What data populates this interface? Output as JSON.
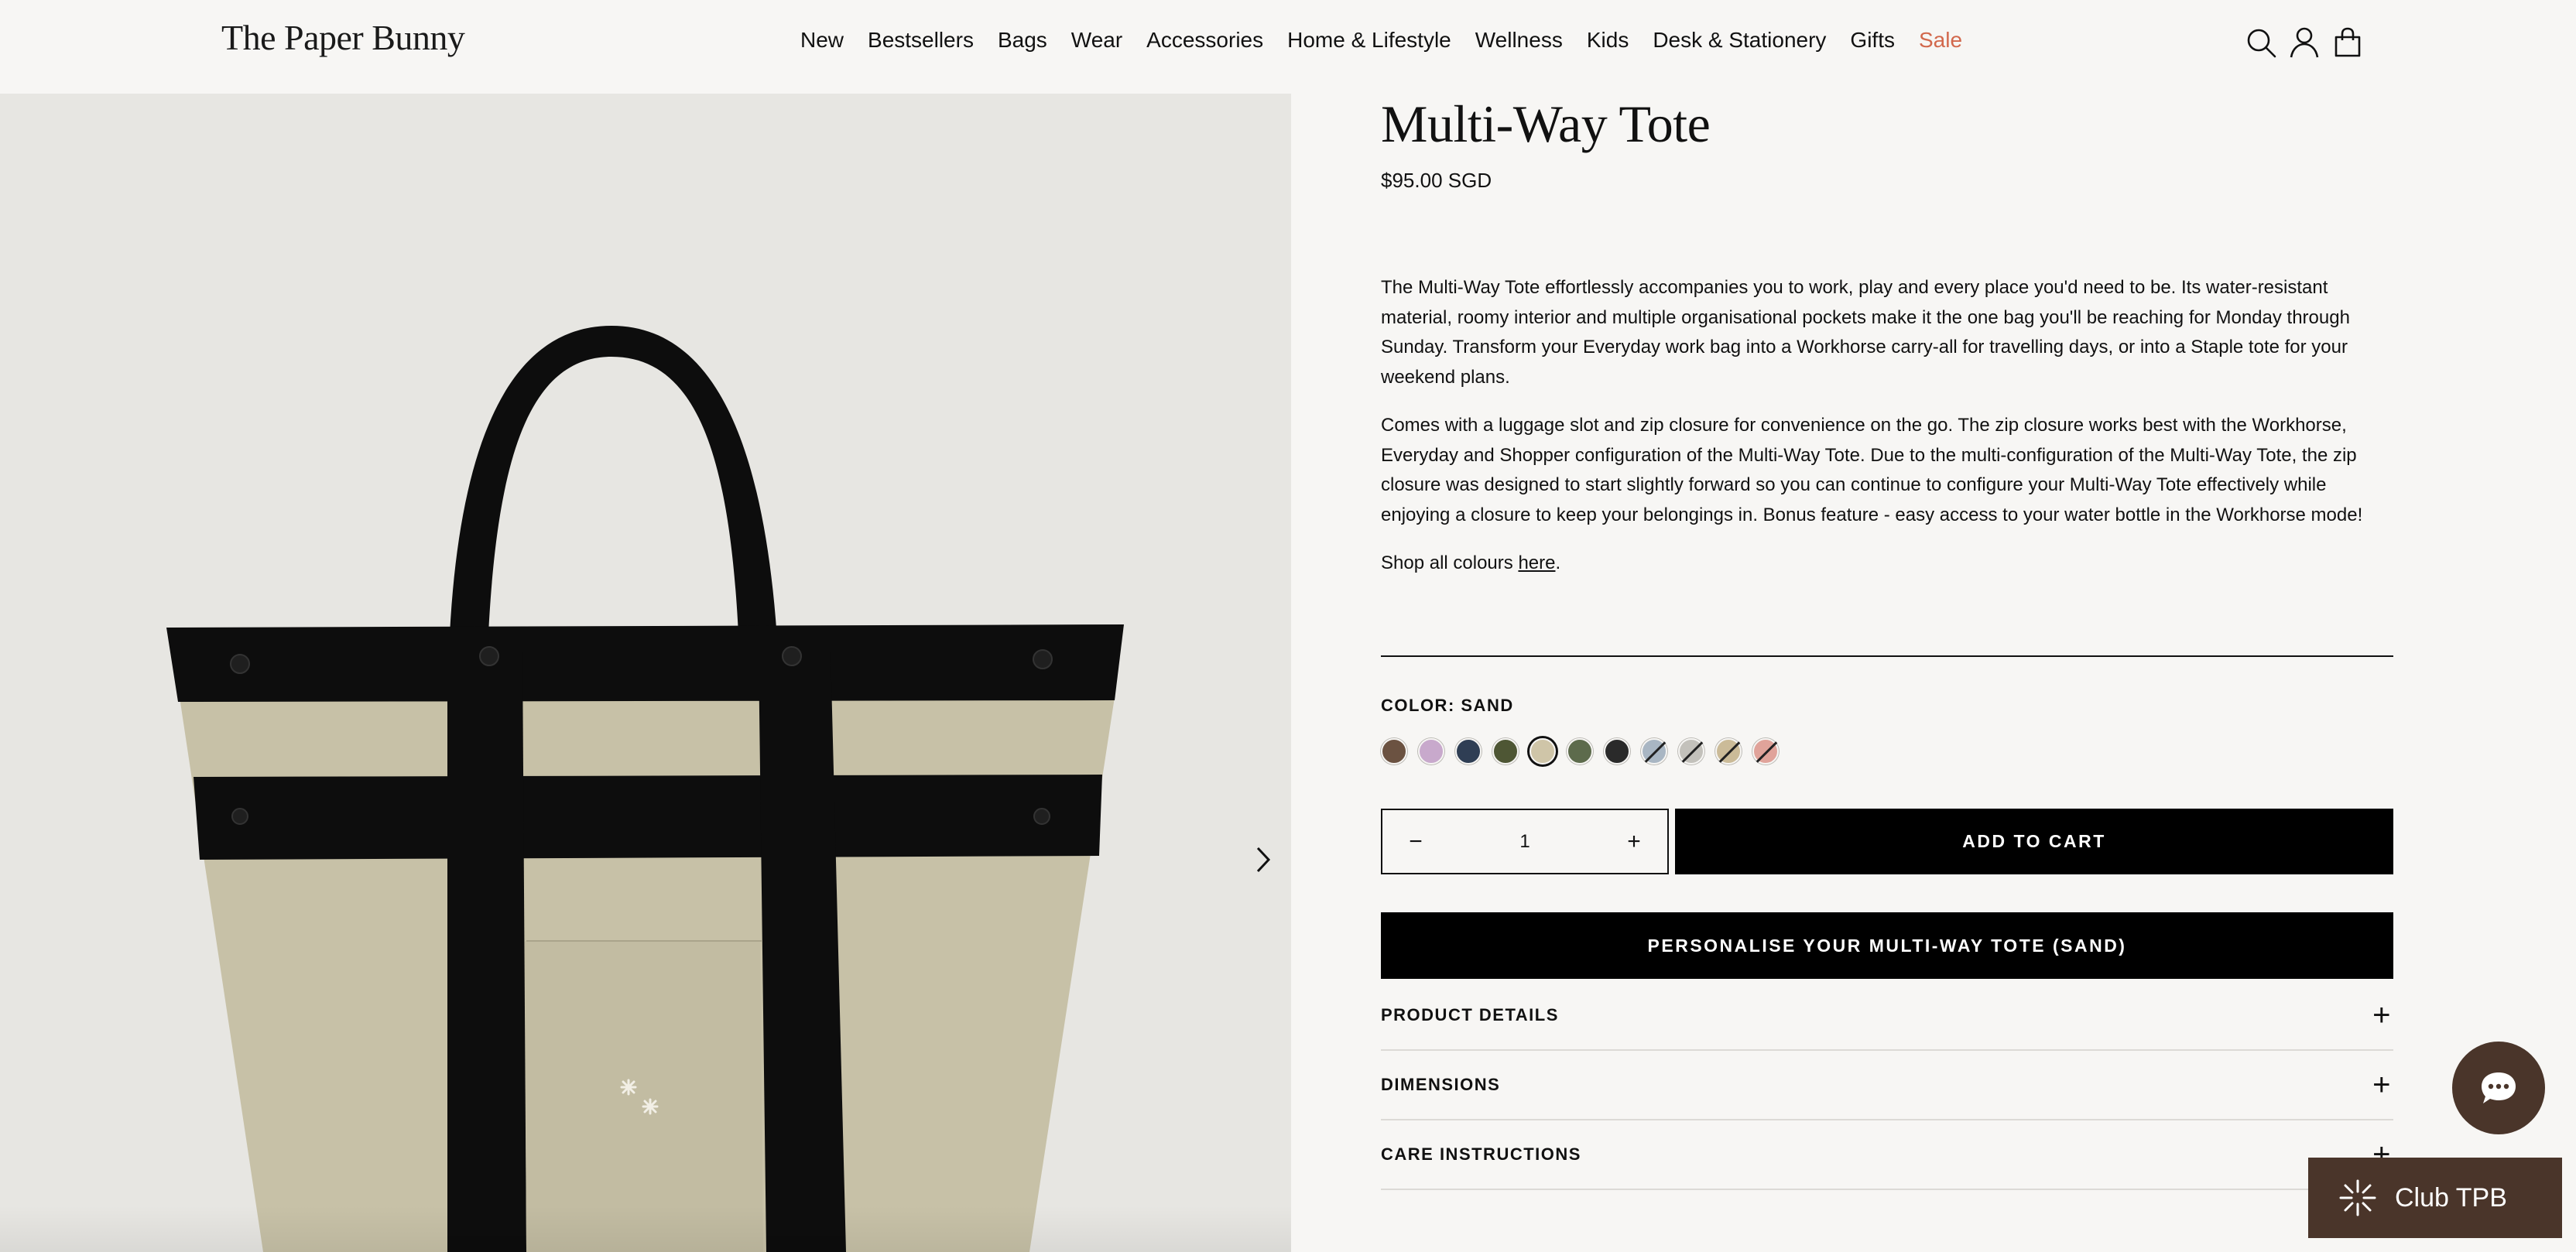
{
  "header": {
    "logo": "The Paper Bunny",
    "nav": [
      "New",
      "Bestsellers",
      "Bags",
      "Wear",
      "Accessories",
      "Home & Lifestyle",
      "Wellness",
      "Kids",
      "Desk & Stationery",
      "Gifts",
      "Sale"
    ],
    "icons": [
      "search-icon",
      "account-icon",
      "cart-bag-icon"
    ]
  },
  "product": {
    "title": "Multi-Way Tote",
    "price": "$95.00 SGD",
    "description": [
      "The Multi-Way Tote effortlessly accompanies you to work, play and every place you'd need to be. Its water-resistant material, roomy interior and multiple organisational pockets make it the one bag you'll be reaching for Monday through Sunday. Transform your Everyday work bag into a Workhorse carry-all for travelling days, or into a Staple tote for your weekend plans.",
      "Comes with a luggage slot and zip closure for convenience on the go. The zip closure works best with the Workhorse, Everyday and Shopper configuration of the Multi-Way Tote. Due to the multi-configuration of the Multi-Way Tote, the zip closure was designed to start slightly forward so you can continue to configure your Multi-Way Tote effectively while enjoying a closure to keep your belongings in. Bonus feature - easy access to your water bottle in the Workhorse mode!"
    ],
    "shop_all_prefix": "Shop all colours ",
    "shop_all_link": "here",
    "shop_all_suffix": ".",
    "color_label": "COLOR: SAND",
    "swatches": [
      {
        "color": "#6b5241",
        "split": false
      },
      {
        "color": "#c8a9cc",
        "split": false
      },
      {
        "color": "#2f3e54",
        "split": false
      },
      {
        "color": "#4e5634",
        "split": false
      },
      {
        "color": "#cfc5a8",
        "split": false,
        "selected": true
      },
      {
        "color": "#5d6b4c",
        "split": false
      },
      {
        "color": "#2a2a2a",
        "split": false
      },
      {
        "color": "#a9b6c3",
        "split": true
      },
      {
        "color": "#c3c1bb",
        "split": true
      },
      {
        "color": "#cbbb98",
        "split": true
      },
      {
        "color": "#e0a39a",
        "split": true
      }
    ],
    "quantity": "1",
    "qty_minus": "−",
    "qty_plus": "+",
    "add_to_cart": "ADD TO CART",
    "personalise": "PERSONALISE YOUR MULTI-WAY TOTE (SAND)",
    "accordion": [
      "PRODUCT DETAILS",
      "DIMENSIONS",
      "CARE INSTRUCTIONS"
    ]
  },
  "widgets": {
    "chat_icon": "chat-bubble-icon",
    "club_label": "Club TPB"
  },
  "colors": {
    "background": "#f7f6f4",
    "sale": "#d2684c",
    "bag_body": "#c7c1a7",
    "strap": "#0d0d0d",
    "widget": "#4a352a"
  }
}
